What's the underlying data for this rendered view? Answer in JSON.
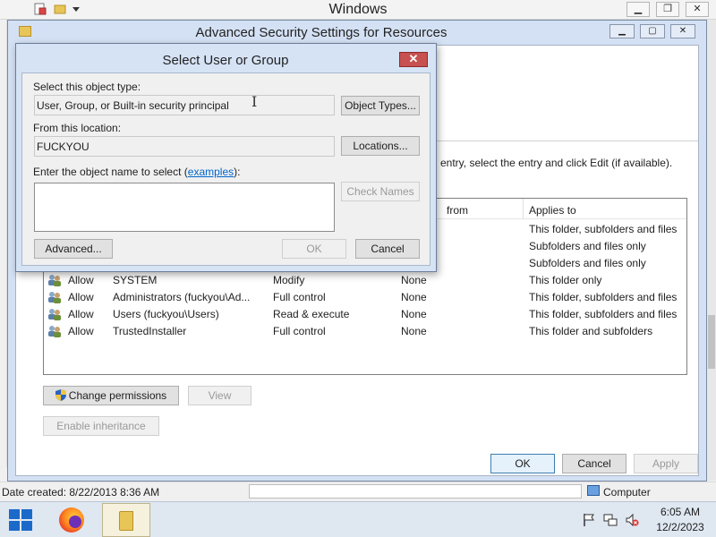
{
  "explorer": {
    "title": "Windows",
    "status_date": "Date created: 8/22/2013 8:36 AM",
    "status_location": "Computer"
  },
  "advanced": {
    "title": "Advanced Security Settings for Resources",
    "instruction_fragment": "entry, select the entry and click Edit (if available).",
    "columns": {
      "inherited_from_fragment": "from",
      "applies_to": "Applies to"
    },
    "rows": [
      {
        "type": "",
        "principal": "",
        "access": "",
        "inherited": "",
        "applies": "This folder, subfolders and files"
      },
      {
        "type": "",
        "principal": "",
        "access": "",
        "inherited": "",
        "applies": "Subfolders and files only"
      },
      {
        "type": "",
        "principal": "",
        "access": "",
        "inherited": "",
        "applies": "Subfolders and files only"
      },
      {
        "type": "Allow",
        "principal": "SYSTEM",
        "access": "Modify",
        "inherited": "None",
        "applies": "This folder only"
      },
      {
        "type": "Allow",
        "principal": "Administrators (fuckyou\\Ad...",
        "access": "Full control",
        "inherited": "None",
        "applies": "This folder, subfolders and files"
      },
      {
        "type": "Allow",
        "principal": "Users (fuckyou\\Users)",
        "access": "Read & execute",
        "inherited": "None",
        "applies": "This folder, subfolders and files"
      },
      {
        "type": "Allow",
        "principal": "TrustedInstaller",
        "access": "Full control",
        "inherited": "None",
        "applies": "This folder and subfolders"
      }
    ],
    "buttons": {
      "change_permissions": "Change permissions",
      "view": "View",
      "enable_inheritance": "Enable inheritance",
      "ok": "OK",
      "cancel": "Cancel",
      "apply": "Apply"
    }
  },
  "select_dialog": {
    "title": "Select User or Group",
    "close_glyph": "✕",
    "object_type_label": "Select this object type:",
    "object_type_value": "User, Group, or Built-in security principal",
    "object_types_button": "Object Types...",
    "location_label": "From this location:",
    "location_value": "FUCKYOU",
    "locations_button": "Locations...",
    "name_label_prefix": "Enter the object name to select (",
    "name_label_link": "examples",
    "name_label_suffix": "):",
    "object_name_value": "",
    "check_names_button": "Check Names",
    "advanced_button": "Advanced...",
    "ok_button": "OK",
    "cancel_button": "Cancel"
  },
  "taskbar": {
    "time": "6:05 AM",
    "date": "12/2/2023"
  }
}
